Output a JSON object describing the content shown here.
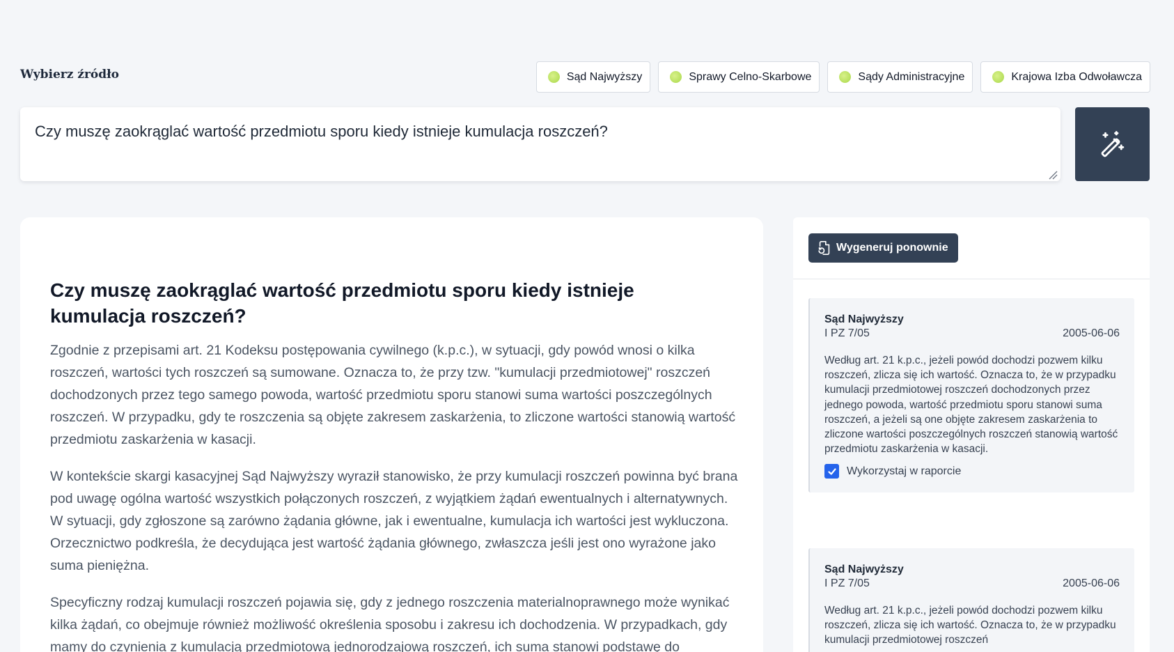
{
  "source_selector": {
    "label": "Wybierz źródło",
    "options": [
      {
        "label": "Sąd Najwyższy"
      },
      {
        "label": "Sprawy Celno-Skarbowe"
      },
      {
        "label": "Sądy Administracyjne"
      },
      {
        "label": "Krajowa Izba Odwoławcza"
      }
    ]
  },
  "query": {
    "value": "Czy muszę zaokrąglać wartość przedmiotu sporu kiedy istnieje kumulacja roszczeń?"
  },
  "answer": {
    "title": "Czy muszę zaokrąglać wartość przedmiotu sporu kiedy istnieje kumulacja roszczeń?",
    "paragraphs": [
      "Zgodnie z przepisami art. 21 Kodeksu postępowania cywilnego (k.p.c.), w sytuacji, gdy powód wnosi o kilka roszczeń, wartości tych roszczeń są sumowane. Oznacza to, że przy tzw. \"kumulacji przedmiotowej\" roszczeń dochodzonych przez tego samego powoda, wartość przedmiotu sporu stanowi suma wartości poszczególnych roszczeń. W przypadku, gdy te roszczenia są objęte zakresem zaskarżenia, to zliczone wartości stanowią wartość przedmiotu zaskarżenia w kasacji.",
      "W kontekście skargi kasacyjnej Sąd Najwyższy wyraził stanowisko, że przy kumulacji roszczeń powinna być brana pod uwagę ogólna wartość wszystkich połączonych roszczeń, z wyjątkiem żądań ewentualnych i alternatywnych. W sytuacji, gdy zgłoszone są zarówno żądania główne, jak i ewentualne, kumulacja ich wartości jest wykluczona. Orzecznictwo podkreśla, że decydująca jest wartość żądania głównego, zwłaszcza jeśli jest ono wyrażone jako suma pieniężna.",
      "Specyficzny rodzaj kumulacji roszczeń pojawia się, gdy z jednego roszczenia materialnoprawnego może wynikać kilka żądań, co obejmuje również możliwość określenia sposobu i zakresu ich dochodzenia. W przypadkach, gdy mamy do czynienia z kumulacją przedmiotową jednorodzajową roszczeń, ich suma stanowi podstawę do"
    ]
  },
  "sidebar": {
    "regenerate_label": "Wygeneruj ponownie",
    "references": [
      {
        "court": "Sąd Najwyższy",
        "signature": "I PZ 7/05",
        "date": "2005-06-06",
        "text": "Według art. 21 k.p.c., jeżeli powód dochodzi pozwem kilku roszczeń, zlicza się ich wartość. Oznacza to, że w przypadku kumulacji przedmiotowej roszczeń dochodzonych przez jednego powoda, wartość przedmiotu sporu stanowi suma roszczeń, a jeżeli są one objęte zakresem zaskarżenia to zliczone wartości poszczególnych roszczeń stanowią wartość przedmiotu zaskarżenia w kasacji.",
        "use_label": "Wykorzystaj w raporcie",
        "checked": true
      },
      {
        "court": "Sąd Najwyższy",
        "signature": "I PZ 7/05",
        "date": "2005-06-06",
        "text": "Według art. 21 k.p.c., jeżeli powód dochodzi pozwem kilku roszczeń, zlicza się ich wartość. Oznacza to, że w przypadku kumulacji przedmiotowej roszczeń"
      }
    ]
  },
  "colors": {
    "dark_button": "#334155",
    "status_dot": "#b9e35c",
    "checkbox": "#2563eb"
  }
}
